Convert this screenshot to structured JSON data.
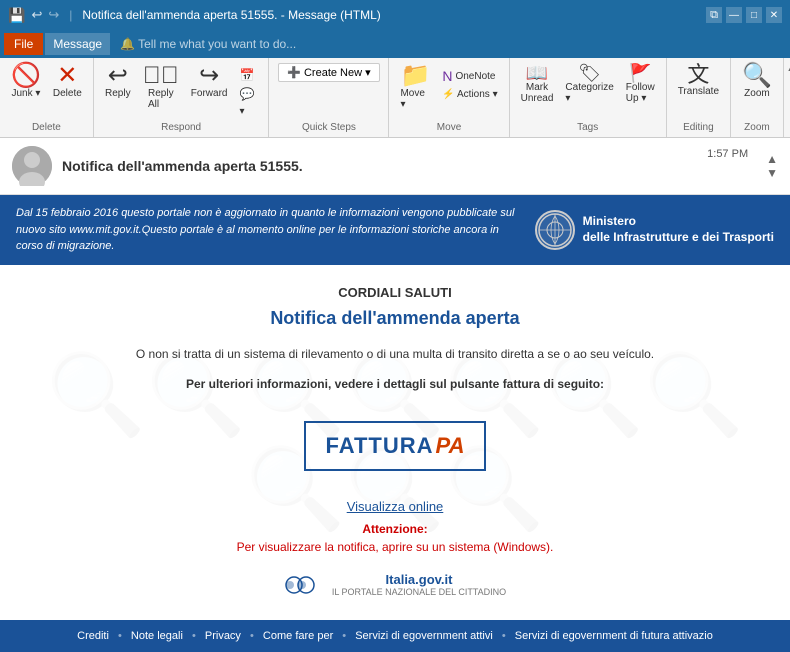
{
  "titlebar": {
    "icon": "✉",
    "title": "Notifica dell'ammenda aperta 51555. - Message (HTML)",
    "controls": [
      "—",
      "□",
      "✕"
    ]
  },
  "menubar": {
    "file": "File",
    "items": [
      "Message",
      "🔔 Tell me what you want to do..."
    ]
  },
  "ribbon": {
    "groups": [
      {
        "label": "Delete",
        "buttons": [
          {
            "icon": "🚫",
            "label": "Junk"
          },
          {
            "icon": "✕",
            "label": "Delete"
          }
        ]
      },
      {
        "label": "Respond",
        "buttons": [
          {
            "icon": "↩",
            "label": "Reply"
          },
          {
            "icon": "↩↩",
            "label": "Reply All"
          },
          {
            "icon": "→",
            "label": "Forward"
          }
        ]
      },
      {
        "label": "Quick Steps",
        "items": [
          "➕ Create New"
        ]
      },
      {
        "label": "Move",
        "buttons": [
          {
            "icon": "📁",
            "label": "Move"
          }
        ]
      },
      {
        "label": "Tags",
        "buttons": [
          {
            "icon": "📖",
            "label": "Mark Unread"
          },
          {
            "icon": "🏷",
            "label": "Categorize"
          },
          {
            "icon": "🚩",
            "label": "Follow Up"
          }
        ]
      },
      {
        "label": "Editing",
        "buttons": [
          {
            "icon": "文",
            "label": "Translate"
          }
        ]
      },
      {
        "label": "Zoom",
        "buttons": [
          {
            "icon": "🔍",
            "label": "Zoom"
          }
        ]
      }
    ]
  },
  "email": {
    "sender_initials": "👤",
    "sender_name": "",
    "subject": "Notifica dell'ammenda aperta 51555.",
    "time": "1:57 PM",
    "body": {
      "banner": {
        "text": "Dal 15 febbraio 2016 questo portale non è aggiornato in quanto le informazioni vengono pubblicate sul nuovo sito www.mit.gov.it.Questo portale è al momento online per le informazioni storiche ancora in corso di migrazione.",
        "ministry_name": "Ministero\ndelle Infrastrutture e dei Trasporti"
      },
      "greeting": "CORDIALI SALUTI",
      "title": "Notifica dell'ammenda aperta",
      "paragraph1": "O non si tratta di un sistema di rilevamento o di una multa di transito diretta\na se o ao seu veículo.",
      "paragraph2": "Per ulteriori informazioni, vedere i dettagli sul pulsante fattura di seguito:",
      "fattura_text": "FATTURA",
      "fattura_pa": "PA",
      "visualizza": "Visualizza online",
      "attenzione_label": "Attenzione:",
      "attenzione_text": "Per visualizzare la notifica, aprire su un sistema (Windows).",
      "logo_text": "Italia.gov.it",
      "logo_sub": "IL PORTALE NAZIONALE DEL CITTADINO"
    },
    "footer": {
      "links": [
        "Crediti",
        "Note legali",
        "Privacy",
        "Come fare per",
        "Servizi di egovernment attivi",
        "Servizi di egovernment di futura attivazio"
      ]
    }
  }
}
